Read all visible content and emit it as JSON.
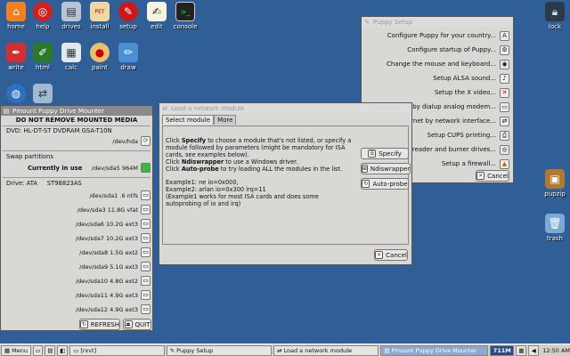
{
  "desktop_icons": [
    {
      "name": "home",
      "label": "home"
    },
    {
      "name": "help",
      "label": "help"
    },
    {
      "name": "drives",
      "label": "drives"
    },
    {
      "name": "install",
      "label": "install"
    },
    {
      "name": "setup",
      "label": "setup"
    },
    {
      "name": "edit",
      "label": "edit"
    },
    {
      "name": "console",
      "label": "console"
    },
    {
      "name": "write",
      "label": "write"
    },
    {
      "name": "html",
      "label": "html"
    },
    {
      "name": "calc",
      "label": "calc"
    },
    {
      "name": "paint",
      "label": "paint"
    },
    {
      "name": "draw",
      "label": "draw"
    },
    {
      "name": "lock",
      "label": "lock"
    },
    {
      "name": "pupzip",
      "label": "pupzip"
    },
    {
      "name": "trash",
      "label": "trash"
    }
  ],
  "puppy_setup": {
    "title": "Puppy Setup",
    "items": [
      "Configure Puppy for your country...",
      "Configure startup of Puppy...",
      "Change the mouse and keyboard...",
      "Setup ALSA sound...",
      "Setup the X video...",
      "Connect by dialup analog modem...",
      "Connect to Internet by network interface...",
      "Setup CUPS printing...",
      "CD/DVD reader and burner drives...",
      "Setup a firewall..."
    ],
    "cancel": "Cancel"
  },
  "network_module": {
    "title": "Load a network module",
    "tabs": [
      "Select module",
      "More"
    ],
    "para1_pre": "Click ",
    "para1_b": "Specify",
    "para1_post": " to choose a module that's not listed, or specify a module followed by parameters (might be mandatory for ISA cards, see examples below).",
    "para2_pre": "Click ",
    "para2_b": "Ndiswrapper",
    "para2_post": " to use a Windows driver.",
    "para3_pre": "Click ",
    "para3_b": "Auto-probe",
    "para3_post": " to try loading ALL the modules in the list.",
    "ex1": "Example1: ne io=0x000,",
    "ex2": "Example2: arlan  io=0x300 irq=11",
    "ex3": "(Example1 works for most ISA cards and does some autoprobing of io and irq)",
    "buttons": [
      "Specify",
      "Ndiswrapper",
      "Auto-probe"
    ],
    "cancel": "Cancel"
  },
  "drive_mounter": {
    "title": "Pmount Puppy Drive Mounter",
    "warning": "DO NOT REMOVE MOUNTED MEDIA",
    "dvd_label": "DVD: HL-DT-ST DVDRAM GSA-T10N",
    "dvd_dev": "/dev/hda",
    "swap_label": "Swap partitions",
    "swap_status": "Currently in use",
    "swap_dev": "/dev/sda5 964M",
    "drive_label": "Drive: ATA     ST98823AS",
    "partitions": [
      "/dev/sda1 .6 ntfs",
      "/dev/sda3 11.8G vfat",
      "/dev/sda6 10.2G ext3",
      "/dev/sda7 10.2G ext3",
      "/dev/sda8 1.5G ext2",
      "/dev/sda9 5.1G ext3",
      "/dev/sda10 4.8G ext2",
      "/dev/sda11 4.9G ext3",
      "/dev/sda12 4.9G ext3"
    ],
    "refresh": "REFRESH",
    "quit": "QUIT"
  },
  "taskbar": {
    "menu": "Menu",
    "tasks": [
      "[rxvt]",
      "Puppy Setup",
      "Load a network module",
      "Pmount Puppy Drive Mounter"
    ],
    "memory": "711M",
    "clock": "12:50 AM"
  }
}
